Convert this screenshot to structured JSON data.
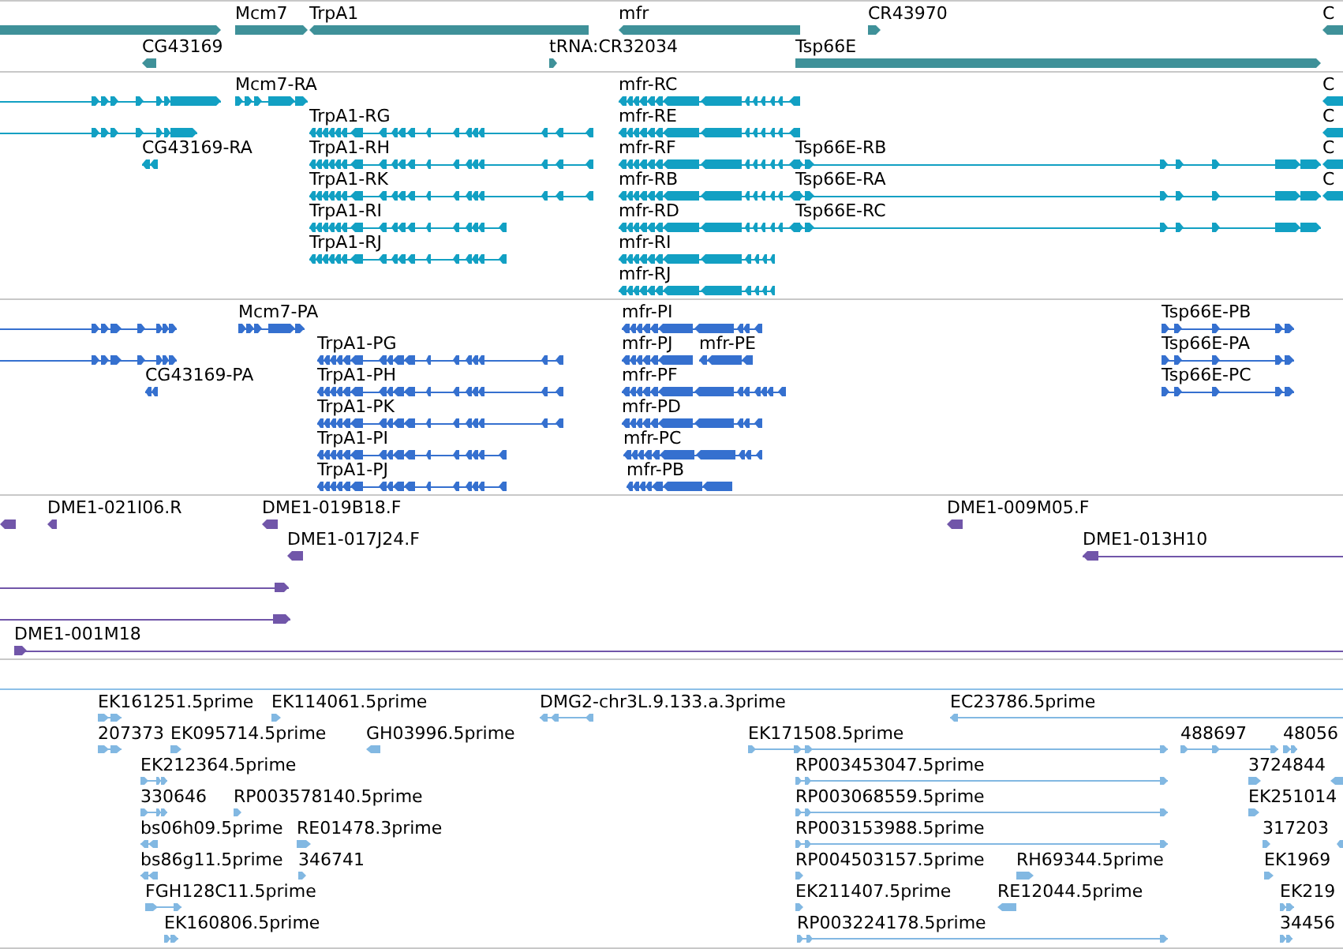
{
  "tracks": [
    {
      "kind": "gene",
      "color": "#3f9199",
      "features": [
        {
          "reverse": false
        },
        {
          "label": "Mcm7",
          "reverse": false
        },
        {
          "label": "TrpA1",
          "reverse": true
        },
        {
          "label": "mfr",
          "reverse": true
        },
        {
          "label": "CR43970",
          "reverse": false
        },
        {
          "label": "C",
          "reverse": true
        },
        {
          "label": "CG43169",
          "reverse": true
        },
        {
          "label": "tRNA:CR32034",
          "reverse": false
        },
        {
          "label": "Tsp66E",
          "reverse": false
        }
      ]
    },
    {
      "kind": "transcript",
      "color": "#12a0c3",
      "features": [
        {
          "reverse": false
        },
        {
          "label": "Mcm7-RA",
          "reverse": false
        },
        {
          "label": "mfr-RC",
          "reverse": true
        },
        {
          "label": "C",
          "reverse": true
        },
        {
          "reverse": false
        },
        {
          "label": "TrpA1-RG",
          "reverse": true
        },
        {
          "label": "mfr-RE",
          "reverse": true
        },
        {
          "label": "C",
          "reverse": true
        },
        {
          "label": "CG43169-RA",
          "reverse": true
        },
        {
          "label": "TrpA1-RH",
          "reverse": true
        },
        {
          "label": "mfr-RF",
          "reverse": true
        },
        {
          "label": "Tsp66E-RB",
          "reverse": false
        },
        {
          "label": "C",
          "reverse": true
        },
        {
          "label": "TrpA1-RK",
          "reverse": true
        },
        {
          "label": "mfr-RB",
          "reverse": true
        },
        {
          "label": "Tsp66E-RA",
          "reverse": false
        },
        {
          "label": "C",
          "reverse": true
        },
        {
          "label": "TrpA1-RI",
          "reverse": true
        },
        {
          "label": "mfr-RD",
          "reverse": true
        },
        {
          "label": "Tsp66E-RC",
          "reverse": false
        },
        {
          "label": "TrpA1-RJ",
          "reverse": true
        },
        {
          "label": "mfr-RI",
          "reverse": true
        },
        {
          "label": "mfr-RJ",
          "reverse": true
        }
      ]
    },
    {
      "kind": "protein",
      "color": "#3570cf",
      "features": [
        {
          "reverse": false
        },
        {
          "label": "Mcm7-PA",
          "reverse": false
        },
        {
          "label": "mfr-PI",
          "reverse": true
        },
        {
          "label": "Tsp66E-PB",
          "reverse": false
        },
        {
          "reverse": false
        },
        {
          "label": "TrpA1-PG",
          "reverse": true
        },
        {
          "label": "mfr-PJ",
          "reverse": true
        },
        {
          "label": "mfr-PE",
          "reverse": true
        },
        {
          "label": "Tsp66E-PA",
          "reverse": false
        },
        {
          "label": "CG43169-PA",
          "reverse": true
        },
        {
          "label": "TrpA1-PH",
          "reverse": true
        },
        {
          "label": "mfr-PF",
          "reverse": true
        },
        {
          "label": "Tsp66E-PC",
          "reverse": false
        },
        {
          "label": "TrpA1-PK",
          "reverse": true
        },
        {
          "label": "mfr-PD",
          "reverse": true
        },
        {
          "label": "TrpA1-PI",
          "reverse": true
        },
        {
          "label": "mfr-PC",
          "reverse": true
        },
        {
          "label": "TrpA1-PJ",
          "reverse": true
        },
        {
          "label": "mfr-PB",
          "reverse": true
        }
      ]
    },
    {
      "kind": "bac_end",
      "color": "#7156a9",
      "features": [
        {
          "reverse": true
        },
        {
          "label": "DME1-021I06.R",
          "reverse": true
        },
        {
          "label": "DME1-019B18.F",
          "reverse": true
        },
        {
          "label": "DME1-009M05.F",
          "reverse": true
        },
        {
          "label": "DME1-017J24.F",
          "reverse": true
        },
        {
          "label": "DME1-013H10",
          "reverse": true
        },
        {
          "reverse": false
        },
        {
          "reverse": false
        },
        {
          "label": "DME1-001M18",
          "reverse": false
        }
      ]
    },
    {
      "kind": "est",
      "color": "#82b8e2",
      "features": [
        {
          "label": "EK161251.5prime",
          "reverse": false
        },
        {
          "label": "EK114061.5prime",
          "reverse": false
        },
        {
          "label": "DMG2-chr3L.9.133.a.3prime",
          "reverse": true
        },
        {
          "label": "EC23786.5prime",
          "reverse": true
        },
        {
          "label": "207373",
          "reverse": false
        },
        {
          "label": "EK095714.5prime",
          "reverse": false
        },
        {
          "label": "GH03996.5prime",
          "reverse": true
        },
        {
          "label": "EK171508.5prime",
          "reverse": false
        },
        {
          "label": "488697",
          "reverse": false
        },
        {
          "label": "48056",
          "reverse": false
        },
        {
          "label": "EK212364.5prime",
          "reverse": false
        },
        {
          "label": "RP003453047.5prime",
          "reverse": false
        },
        {
          "label": "3724844",
          "reverse": false
        },
        {
          "reverse": true
        },
        {
          "label": "330646",
          "reverse": false
        },
        {
          "label": "RP003578140.5prime",
          "reverse": false
        },
        {
          "label": "RP003068559.5prime",
          "reverse": false
        },
        {
          "label": "EK251014",
          "reverse": false
        },
        {
          "label": "bs06h09.5prime",
          "reverse": true
        },
        {
          "label": "RE01478.3prime",
          "reverse": false
        },
        {
          "label": "RP003153988.5prime",
          "reverse": false
        },
        {
          "label": "317203",
          "reverse": false
        },
        {
          "reverse": true
        },
        {
          "label": "bs86g11.5prime",
          "reverse": true
        },
        {
          "label": "346741",
          "reverse": false
        },
        {
          "label": "RP004503157.5prime",
          "reverse": false
        },
        {
          "label": "RH69344.5prime",
          "reverse": false
        },
        {
          "label": "EK1969",
          "reverse": false
        },
        {
          "label": "FGH128C11.5prime",
          "reverse": false
        },
        {
          "label": "EK211407.5prime",
          "reverse": false
        },
        {
          "label": "RE12044.5prime",
          "reverse": true
        },
        {
          "label": "EK219",
          "reverse": false
        },
        {
          "label": "EK160806.5prime",
          "reverse": false
        },
        {
          "label": "RP003224178.5prime",
          "reverse": false
        },
        {
          "label": "34456",
          "reverse": false
        }
      ]
    }
  ]
}
